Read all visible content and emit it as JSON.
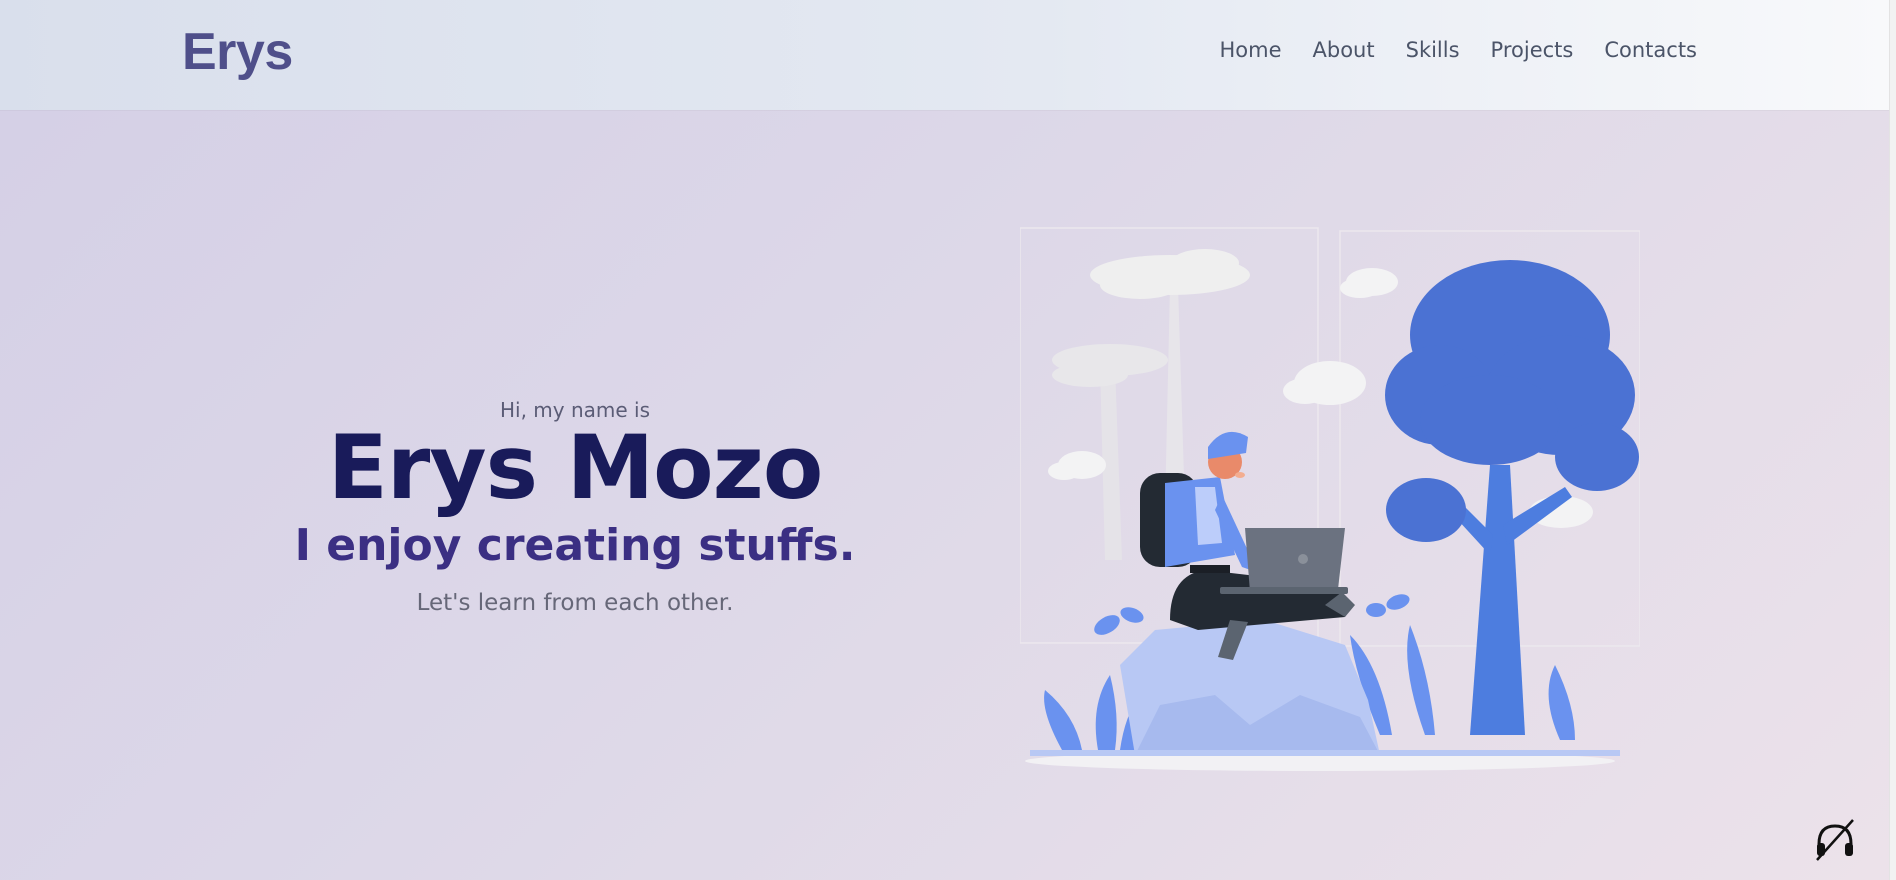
{
  "header": {
    "logo": "Erys",
    "nav": [
      "Home",
      "About",
      "Skills",
      "Projects",
      "Contacts"
    ]
  },
  "hero": {
    "greeting": "Hi, my name is",
    "name": "Erys Mozo",
    "tagline": "I enjoy creating stuffs.",
    "subline": "Let's learn from each other."
  },
  "icons": {
    "corner": "music-off-icon",
    "illustration": "person-laptop-illustration"
  },
  "colors": {
    "logo": "#4f4f8a",
    "name": "#191b5a",
    "tagline": "#3b2f83",
    "accent_blue": "#4b72d3"
  }
}
